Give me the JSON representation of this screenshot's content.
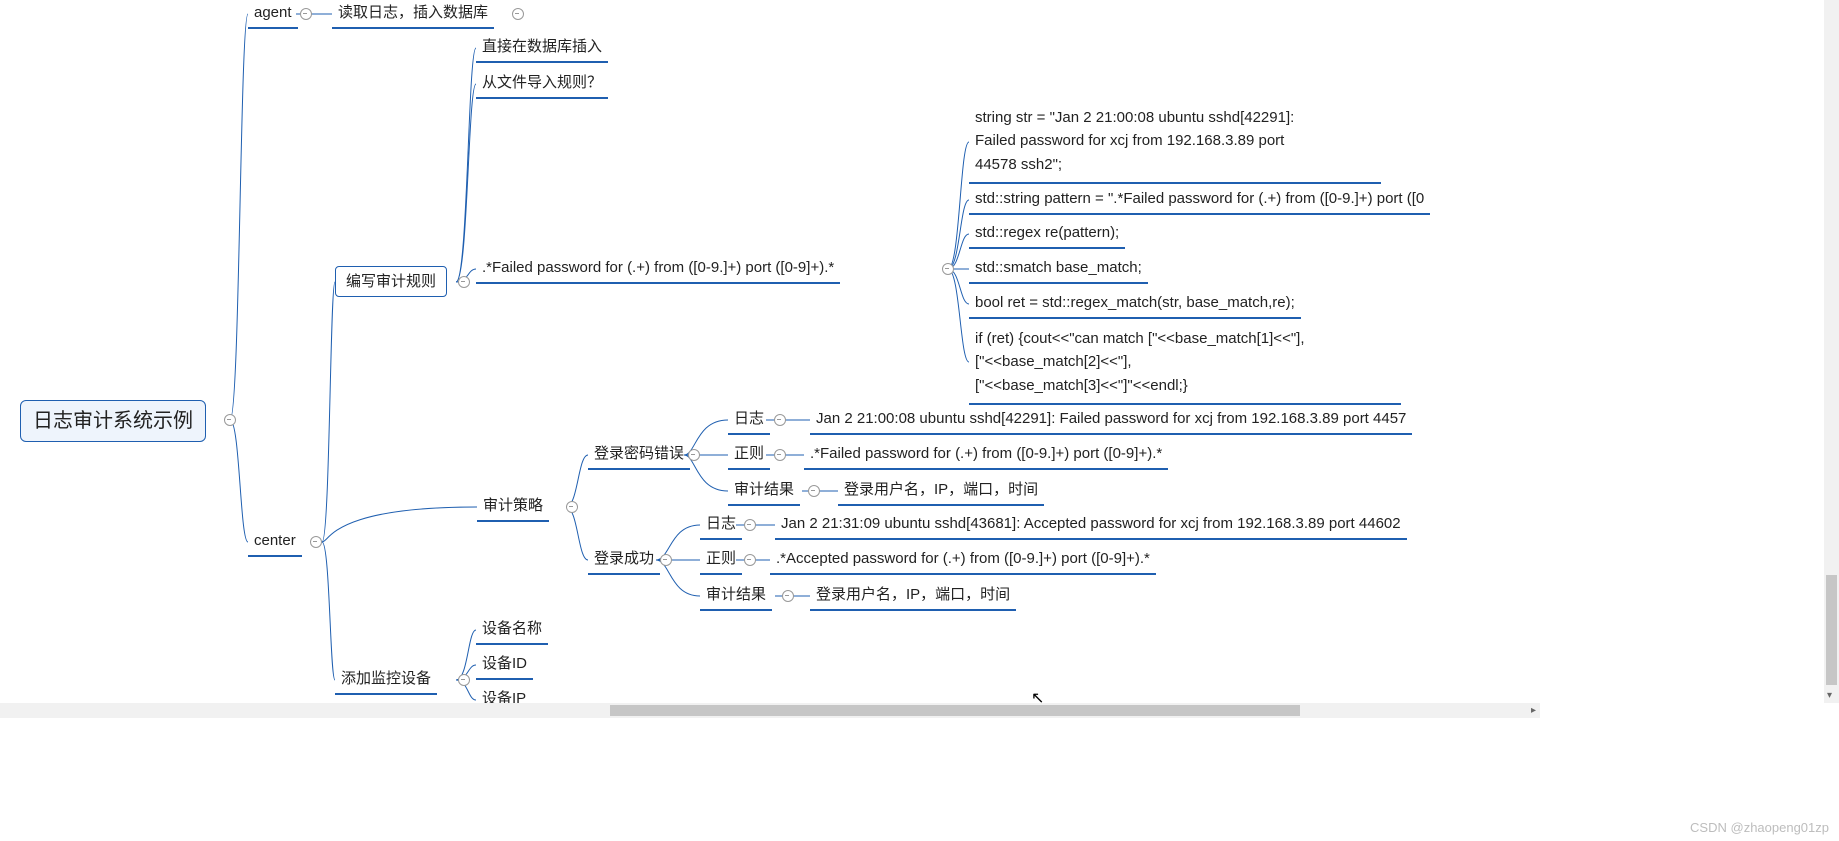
{
  "root": "日志审计系统示例",
  "agent": {
    "label": "agent",
    "child": "读取日志，插入数据库"
  },
  "center": {
    "label": "center",
    "rules": {
      "label": "编写审计规则",
      "direct_db": "直接在数据库插入",
      "import_file": "从文件导入规则？",
      "regex": ".*Failed password for (.+) from ([0-9.]+) port ([0-9]+).*",
      "code": {
        "l1": "string str = \"Jan  2 21:00:08 ubuntu sshd[42291]:\nFailed password for xcj from 192.168.3.89 port\n44578 ssh2\";",
        "l2": "std::string pattern =  \".*Failed password for (.+) from ([0-9.]+) port ([0",
        "l3": "std::regex re(pattern);",
        "l4": "std::smatch base_match;",
        "l5": "bool ret = std::regex_match(str, base_match,re);",
        "l6": "if (ret) {cout<<\"can match [\"<<base_match[1]<<\"],\n[\"<<base_match[2]<<\"],\n[\"<<base_match[3]<<\"]\"<<endl;}"
      }
    },
    "policy": {
      "label": "审计策略",
      "fail": {
        "label": "登录密码错误",
        "log_k": "日志",
        "log_v": "Jan  2 21:00:08 ubuntu sshd[42291]: Failed password for xcj from 192.168.3.89 port 4457",
        "re_k": "正则",
        "re_v": ".*Failed password for (.+) from ([0-9.]+) port ([0-9]+).*",
        "res_k": "审计结果",
        "res_v": "登录用户名，IP，端口，时间"
      },
      "ok": {
        "label": "登录成功",
        "log_k": "日志",
        "log_v": "Jan  2 21:31:09 ubuntu sshd[43681]: Accepted password for xcj from 192.168.3.89 port 44602",
        "re_k": "正则",
        "re_v": ".*Accepted password for (.+) from ([0-9.]+) port ([0-9]+).*",
        "res_k": "审计结果",
        "res_v": "登录用户名，IP，端口，时间"
      }
    },
    "device": {
      "label": "添加监控设备",
      "name": "设备名称",
      "id": "设备ID",
      "ip": "设备IP"
    }
  },
  "watermark": "CSDN @zhaopeng01zp"
}
